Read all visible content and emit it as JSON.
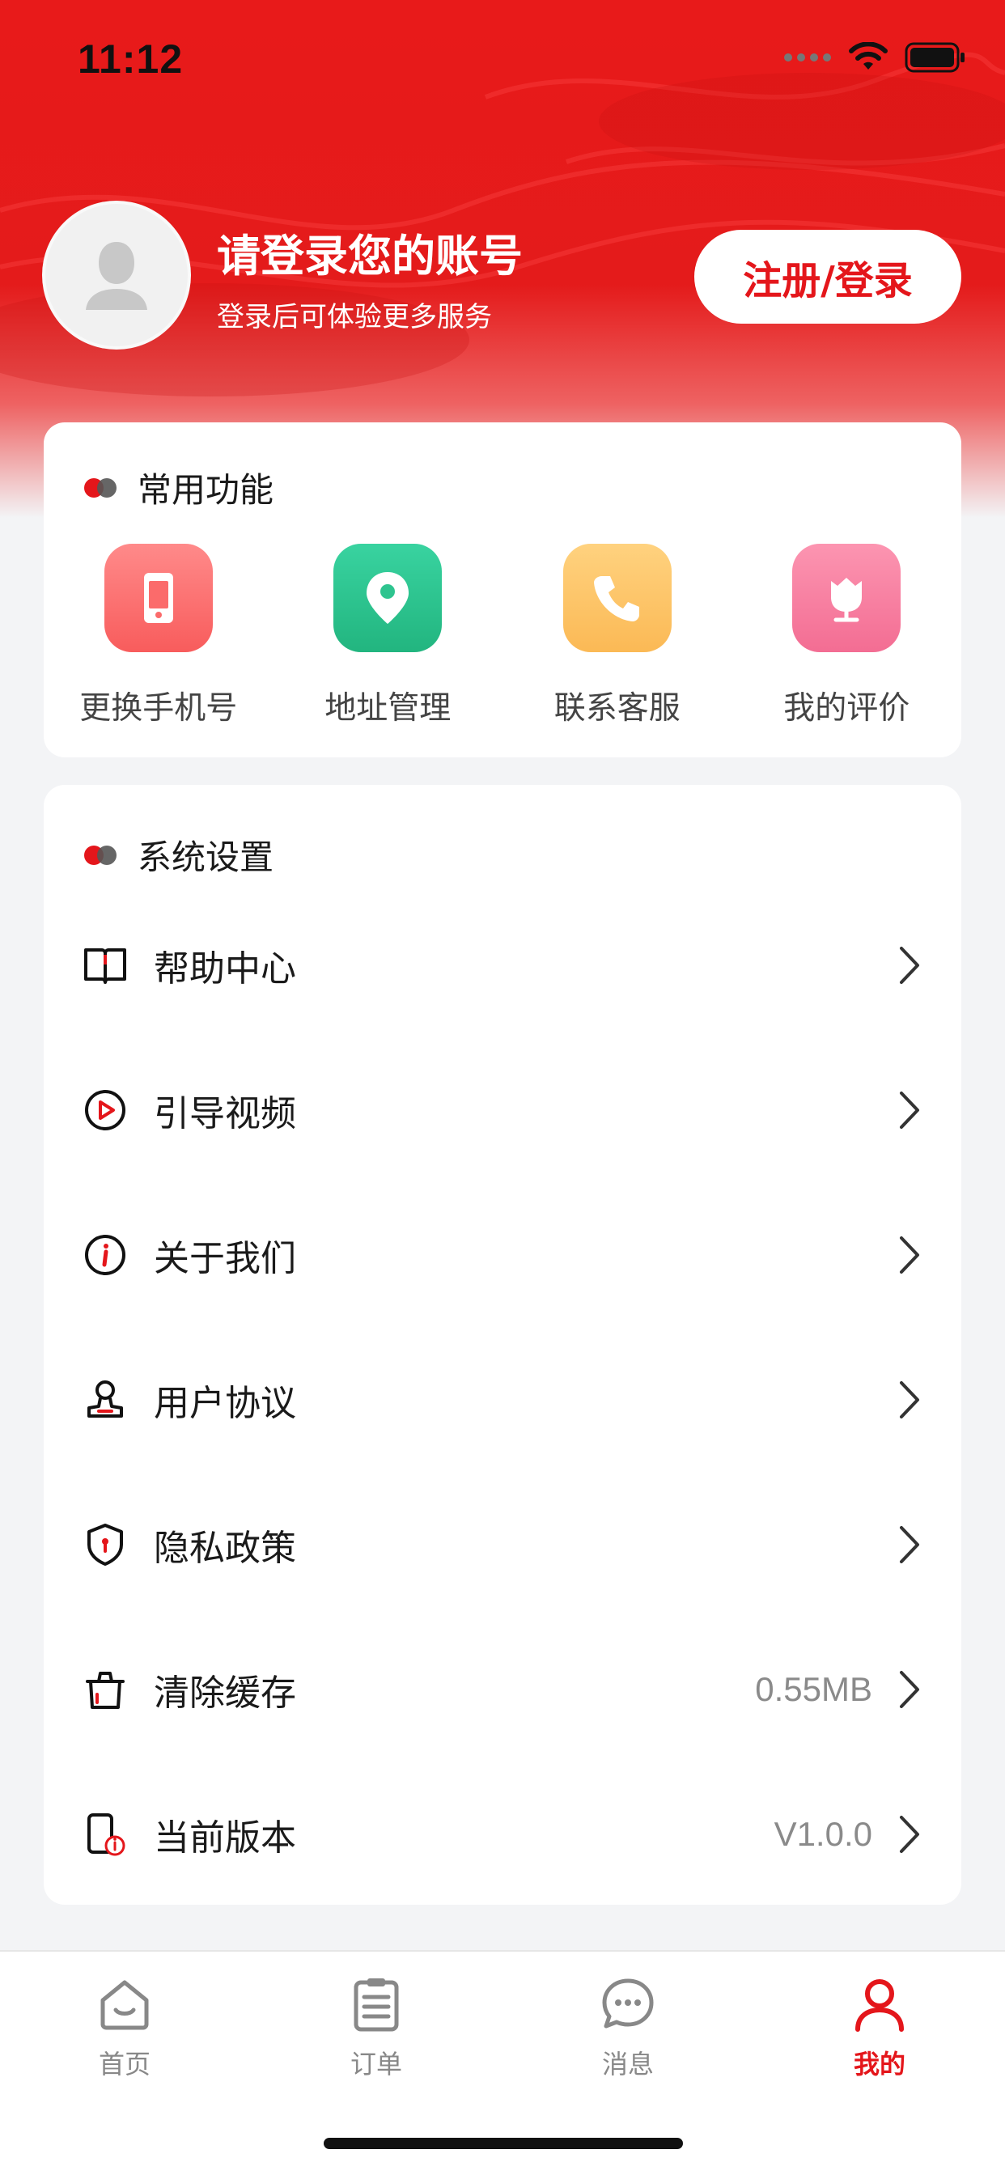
{
  "status_bar": {
    "time": "11:12"
  },
  "profile": {
    "title": "请登录您的账号",
    "subtitle": "登录后可体验更多服务",
    "login_button": "注册/登录"
  },
  "common_functions": {
    "title": "常用功能",
    "items": [
      {
        "label": "更换手机号",
        "icon": "phone-swap-icon",
        "color": "#fb6b6b"
      },
      {
        "label": "地址管理",
        "icon": "location-pin-icon",
        "color": "#2ec48f"
      },
      {
        "label": "联系客服",
        "icon": "phone-call-icon",
        "color": "#fcc56a"
      },
      {
        "label": "我的评价",
        "icon": "flower-icon",
        "color": "#f77fa0"
      }
    ]
  },
  "settings": {
    "title": "系统设置",
    "items": [
      {
        "label": "帮助中心",
        "value": "",
        "icon": "book-icon"
      },
      {
        "label": "引导视频",
        "value": "",
        "icon": "video-play-icon"
      },
      {
        "label": "关于我们",
        "value": "",
        "icon": "info-icon"
      },
      {
        "label": "用户协议",
        "value": "",
        "icon": "stamp-icon"
      },
      {
        "label": "隐私政策",
        "value": "",
        "icon": "shield-icon"
      },
      {
        "label": "清除缓存",
        "value": "0.55MB",
        "icon": "trash-icon"
      },
      {
        "label": "当前版本",
        "value": "V1.0.0",
        "icon": "phone-info-icon"
      }
    ]
  },
  "tabbar": {
    "items": [
      {
        "label": "首页",
        "icon": "home-icon",
        "active": false
      },
      {
        "label": "订单",
        "icon": "order-list-icon",
        "active": false
      },
      {
        "label": "消息",
        "icon": "message-icon",
        "active": false
      },
      {
        "label": "我的",
        "icon": "user-icon",
        "active": true
      }
    ]
  },
  "colors": {
    "accent": "#e4161b",
    "background": "#f3f4f6"
  }
}
